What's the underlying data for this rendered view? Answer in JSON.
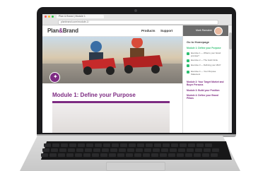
{
  "browser": {
    "tab_title": "Plan & Brand | Module 1",
    "url": "planbrand.com/module-1/",
    "traffic_lights": [
      "#ff5f56",
      "#ffbd2e",
      "#27c93f"
    ]
  },
  "site": {
    "logo_left": "Plan",
    "logo_amp": "&",
    "logo_right": "Brand",
    "nav": [
      "Products",
      "Support"
    ],
    "accent_color": "#7d2b82",
    "complete_color": "#2fbf71"
  },
  "user": {
    "name": "Mark Ramaker"
  },
  "hero": {
    "icon": "lightbulb-icon"
  },
  "main": {
    "module_title": "Module 1: Define your Purpose"
  },
  "sidebar": {
    "goto": "Go to Homepage",
    "module1": "Module 1: Define your Purpose",
    "exercises": [
      "Exercise 1 — What is your brand promise?",
      "Exercise 2 — The Gold Circle",
      "Exercise 3 — Defining your WHY",
      "Exercise 4 — Your Purpose Statement"
    ],
    "module2": "Module 2: Your Target Market and Buyer Persona",
    "module3": "Module 3: Build your Position",
    "module4": "Module 4: Define your Brand Pillars"
  }
}
